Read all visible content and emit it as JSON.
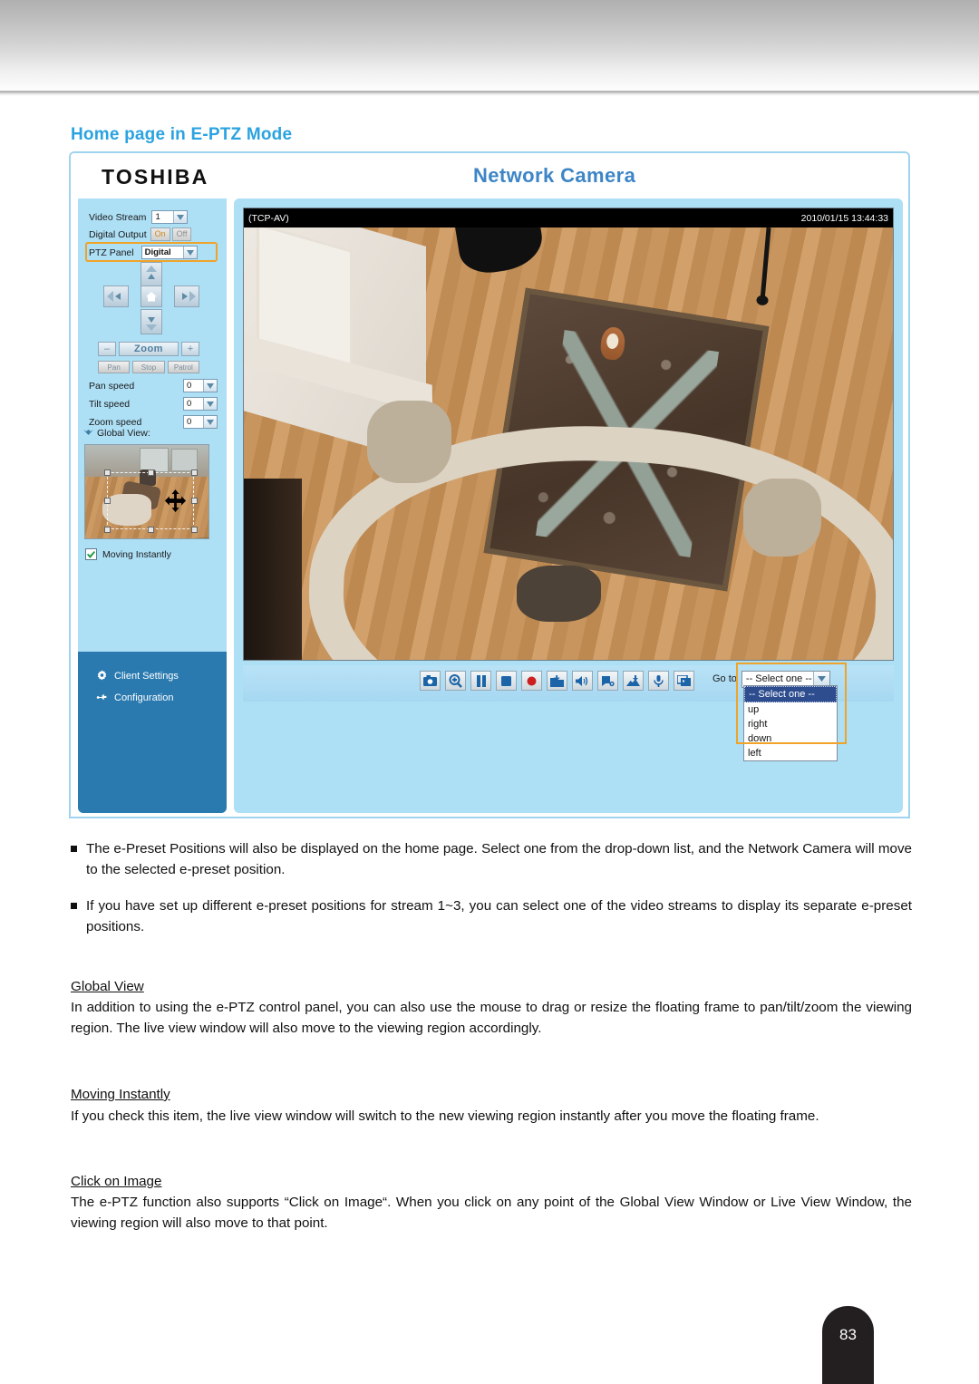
{
  "section": {
    "title": "Home page in E-PTZ Mode"
  },
  "app": {
    "brand": "TOSHIBA",
    "title": "Network Camera",
    "sidebar": {
      "video_stream_label": "Video Stream",
      "video_stream_value": "1",
      "digital_output_label": "Digital Output",
      "digital_output_on": "On",
      "digital_output_off": "Off",
      "ptz_panel_label": "PTZ Panel",
      "ptz_panel_value": "Digital",
      "zoom_minus": "–",
      "zoom_label": "Zoom",
      "zoom_plus": "+",
      "pan_button": "Pan",
      "stop_button": "Stop",
      "patrol_button": "Patrol",
      "pan_speed_label": "Pan speed",
      "pan_speed_value": "0",
      "tilt_speed_label": "Tilt speed",
      "tilt_speed_value": "0",
      "zoom_speed_label": "Zoom speed",
      "zoom_speed_value": "0",
      "global_view_label": "Global View:",
      "moving_instantly_label": "Moving Instantly",
      "moving_instantly_checked": "✓",
      "menu": [
        {
          "label": "Client Settings",
          "icon": "gear-icon"
        },
        {
          "label": "Configuration",
          "icon": "wrench-icon"
        }
      ]
    },
    "video": {
      "osd_left": "(TCP-AV)",
      "osd_right": "2010/01/15 13:44:33"
    },
    "toolbar": {
      "icons": [
        "snapshot-icon",
        "digital-zoom-icon",
        "pause-icon",
        "stop-icon",
        "record-icon",
        "save-folder-icon",
        "volume-icon",
        "talk-icon",
        "storage-icon",
        "microphone-icon",
        "full-screen-icon"
      ]
    },
    "goto": {
      "label": "Go to",
      "selected": "-- Select one --",
      "options": [
        "-- Select one --",
        "up",
        "right",
        "down",
        "left"
      ]
    }
  },
  "body": {
    "bullets": [
      "The e-Preset Positions will also be displayed on the home page. Select one from the drop-down list, and the Network Camera will move to the selected e-preset position.",
      "If you have set up different e-preset positions for stream 1~3, you can select one of the video streams to display its separate e-preset positions."
    ],
    "sections": [
      {
        "heading": "Global View",
        "text": "In addition to using the e-PTZ control panel, you can also use the mouse to drag or resize the floating frame to pan/tilt/zoom the viewing region. The live view window will also move to the viewing region accordingly."
      },
      {
        "heading": "Moving Instantly",
        "text": "If you check this item, the live view window will switch to the new viewing region instantly after you move the floating frame."
      },
      {
        "heading": "Click on Image",
        "text": "The e-PTZ function also supports “Click on Image“. When you click on any point of the Global View Window or Live View Window, the viewing region will also move to that point."
      }
    ]
  },
  "footer": {
    "page_number": "83"
  }
}
